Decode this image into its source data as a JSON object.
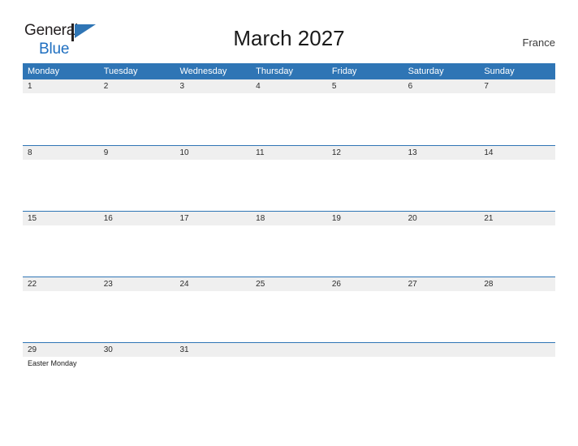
{
  "brand": {
    "name_part_1": "General",
    "name_part_2": "Blue",
    "flag_color": "#2f75b5",
    "text_color_1": "#231f20",
    "text_color_2": "#1f6fc0"
  },
  "header": {
    "title": "March 2027",
    "region": "France"
  },
  "theme": {
    "header_blue": "#2f75b5",
    "date_band_gray": "#efefef",
    "page_background": "#ffffff"
  },
  "calendar": {
    "weekdays": [
      "Monday",
      "Tuesday",
      "Wednesday",
      "Thursday",
      "Friday",
      "Saturday",
      "Sunday"
    ],
    "weeks": [
      {
        "days": [
          {
            "date": "1",
            "events": []
          },
          {
            "date": "2",
            "events": []
          },
          {
            "date": "3",
            "events": []
          },
          {
            "date": "4",
            "events": []
          },
          {
            "date": "5",
            "events": []
          },
          {
            "date": "6",
            "events": []
          },
          {
            "date": "7",
            "events": []
          }
        ]
      },
      {
        "days": [
          {
            "date": "8",
            "events": []
          },
          {
            "date": "9",
            "events": []
          },
          {
            "date": "10",
            "events": []
          },
          {
            "date": "11",
            "events": []
          },
          {
            "date": "12",
            "events": []
          },
          {
            "date": "13",
            "events": []
          },
          {
            "date": "14",
            "events": []
          }
        ]
      },
      {
        "days": [
          {
            "date": "15",
            "events": []
          },
          {
            "date": "16",
            "events": []
          },
          {
            "date": "17",
            "events": []
          },
          {
            "date": "18",
            "events": []
          },
          {
            "date": "19",
            "events": []
          },
          {
            "date": "20",
            "events": []
          },
          {
            "date": "21",
            "events": []
          }
        ]
      },
      {
        "days": [
          {
            "date": "22",
            "events": []
          },
          {
            "date": "23",
            "events": []
          },
          {
            "date": "24",
            "events": []
          },
          {
            "date": "25",
            "events": []
          },
          {
            "date": "26",
            "events": []
          },
          {
            "date": "27",
            "events": []
          },
          {
            "date": "28",
            "events": []
          }
        ]
      },
      {
        "days": [
          {
            "date": "29",
            "events": [
              "Easter Monday"
            ]
          },
          {
            "date": "30",
            "events": []
          },
          {
            "date": "31",
            "events": []
          },
          {
            "date": "",
            "events": []
          },
          {
            "date": "",
            "events": []
          },
          {
            "date": "",
            "events": []
          },
          {
            "date": "",
            "events": []
          }
        ]
      }
    ]
  }
}
